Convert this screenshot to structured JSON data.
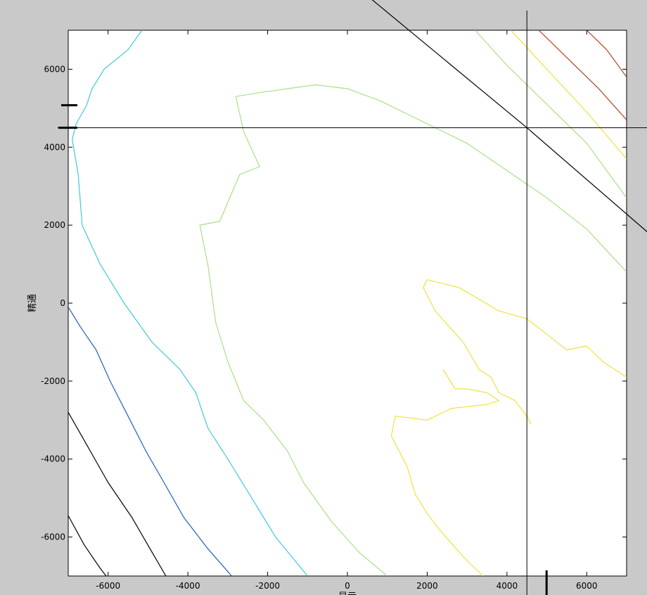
{
  "chart_data": {
    "type": "contour",
    "xlabel": "显示",
    "ylabel": "精通",
    "xlim": [
      -7000,
      7000
    ],
    "ylim": [
      -7000,
      7000
    ],
    "xticks": [
      -6000,
      -4000,
      -2000,
      0,
      2000,
      4000,
      6000
    ],
    "yticks": [
      6000,
      4000,
      2000,
      0,
      -2000,
      -4000,
      -6000
    ],
    "xtick_labels": [
      "-6000",
      "-4000",
      "-2000",
      "0",
      "2000",
      "4000",
      "6000"
    ],
    "ytick_labels": [
      "6000",
      "4000",
      "2000",
      "0",
      "-2000",
      "-4000",
      "-6000"
    ],
    "grid": false,
    "crosshair": {
      "x": 4500,
      "y": 4500
    },
    "series": [
      {
        "color": "#000000",
        "points": [
          [
            -7000,
            -5450
          ],
          [
            -6600,
            -6200
          ],
          [
            -6200,
            -6800
          ],
          [
            -6050,
            -7000
          ]
        ]
      },
      {
        "color": "#000000",
        "points": [
          [
            -7000,
            -2800
          ],
          [
            -6500,
            -3700
          ],
          [
            -6000,
            -4600
          ],
          [
            -5400,
            -5500
          ],
          [
            -4950,
            -6300
          ],
          [
            -4550,
            -7000
          ]
        ]
      },
      {
        "color": "#1f5fbf",
        "points": [
          [
            -7000,
            -100
          ],
          [
            -6700,
            -600
          ],
          [
            -6300,
            -1200
          ],
          [
            -5950,
            -2000
          ],
          [
            -5500,
            -2900
          ],
          [
            -5050,
            -3800
          ],
          [
            -4600,
            -4600
          ],
          [
            -4100,
            -5500
          ],
          [
            -3500,
            -6300
          ],
          [
            -2900,
            -7000
          ]
        ]
      },
      {
        "color": "#40c8e0",
        "points": [
          [
            -5150,
            7000
          ],
          [
            -5500,
            6500
          ],
          [
            -6100,
            6000
          ],
          [
            -6400,
            5500
          ],
          [
            -6550,
            5050
          ],
          [
            -6800,
            4600
          ],
          [
            -6900,
            4200
          ],
          [
            -6750,
            3300
          ],
          [
            -6650,
            2000
          ],
          [
            -6200,
            1000
          ],
          [
            -5600,
            0
          ],
          [
            -4900,
            -1000
          ],
          [
            -4200,
            -1700
          ],
          [
            -3800,
            -2300
          ],
          [
            -3500,
            -3200
          ],
          [
            -3000,
            -4000
          ],
          [
            -2400,
            -5000
          ],
          [
            -1800,
            -6000
          ],
          [
            -1000,
            -7000
          ]
        ]
      },
      {
        "color": "#a8e088",
        "points": [
          [
            -2800,
            5300
          ],
          [
            -2600,
            4400
          ],
          [
            -2200,
            3500
          ],
          [
            -2700,
            3300
          ],
          [
            -3200,
            2100
          ],
          [
            -3700,
            2000
          ],
          [
            -3500,
            1000
          ],
          [
            -3300,
            -500
          ],
          [
            -3000,
            -1500
          ],
          [
            -2600,
            -2500
          ],
          [
            -2100,
            -3000
          ],
          [
            -1500,
            -3800
          ],
          [
            -1100,
            -4600
          ],
          [
            -400,
            -5600
          ],
          [
            300,
            -6400
          ],
          [
            1000,
            -7000
          ]
        ]
      },
      {
        "color": "#a8e088",
        "points": [
          [
            -2800,
            5300
          ],
          [
            -2200,
            5400
          ],
          [
            -1500,
            5500
          ],
          [
            -800,
            5600
          ],
          [
            0,
            5500
          ],
          [
            800,
            5200
          ],
          [
            1800,
            4700
          ],
          [
            3000,
            4100
          ],
          [
            4000,
            3400
          ],
          [
            5000,
            2700
          ],
          [
            6000,
            1900
          ],
          [
            7000,
            800
          ]
        ]
      },
      {
        "color": "#a8e088",
        "points": [
          [
            3200,
            7000
          ],
          [
            4000,
            6100
          ],
          [
            5000,
            5100
          ],
          [
            6000,
            4100
          ],
          [
            7000,
            2700
          ]
        ]
      },
      {
        "color": "#f0e040",
        "points": [
          [
            1900,
            400
          ],
          [
            2000,
            600
          ],
          [
            2800,
            400
          ],
          [
            3800,
            -200
          ],
          [
            4500,
            -400
          ],
          [
            5000,
            -800
          ],
          [
            5500,
            -1200
          ],
          [
            6000,
            -1100
          ],
          [
            6400,
            -1500
          ],
          [
            7000,
            -1900
          ]
        ]
      },
      {
        "color": "#f0e040",
        "points": [
          [
            1900,
            400
          ],
          [
            2200,
            -200
          ],
          [
            2900,
            -1000
          ],
          [
            3300,
            -1700
          ],
          [
            3600,
            -1900
          ],
          [
            3800,
            -2300
          ],
          [
            4200,
            -2500
          ],
          [
            4500,
            -2900
          ],
          [
            4600,
            -3100
          ]
        ]
      },
      {
        "color": "#f0e040",
        "points": [
          [
            2400,
            -1700
          ],
          [
            2700,
            -2200
          ],
          [
            3000,
            -2200
          ],
          [
            3500,
            -2300
          ],
          [
            3800,
            -2500
          ],
          [
            3500,
            -2600
          ],
          [
            2600,
            -2700
          ],
          [
            2000,
            -3000
          ],
          [
            1200,
            -2900
          ],
          [
            1100,
            -3400
          ],
          [
            1500,
            -4200
          ],
          [
            1700,
            -4900
          ],
          [
            2000,
            -5400
          ],
          [
            2300,
            -5800
          ],
          [
            2900,
            -6500
          ],
          [
            3400,
            -7000
          ]
        ]
      },
      {
        "color": "#f0e040",
        "points": [
          [
            4100,
            7000
          ],
          [
            5000,
            6000
          ],
          [
            6000,
            4900
          ],
          [
            7000,
            3700
          ]
        ]
      },
      {
        "color": "#b04020",
        "points": [
          [
            4800,
            7000
          ],
          [
            5600,
            6200
          ],
          [
            6300,
            5500
          ],
          [
            7000,
            4700
          ]
        ]
      },
      {
        "color": "#b04020",
        "points": [
          [
            6000,
            7000
          ],
          [
            6500,
            6500
          ],
          [
            7000,
            5800
          ]
        ]
      },
      {
        "color": "#000000",
        "points": [
          [
            600,
            7800
          ],
          [
            4500,
            4500
          ],
          [
            8000,
            1400
          ]
        ]
      }
    ]
  }
}
